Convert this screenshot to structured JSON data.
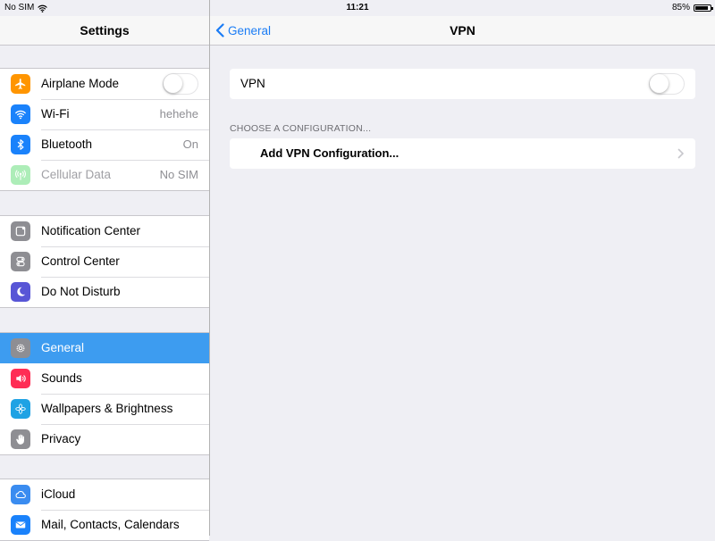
{
  "status_bar": {
    "carrier": "No SIM",
    "time": "11:21",
    "battery_text": "85%",
    "battery_level": 0.85
  },
  "master": {
    "title": "Settings",
    "groups": [
      {
        "items": [
          {
            "label": "Airplane Mode",
            "icon": "airplane-icon",
            "color": "#ff9500",
            "toggle": false
          },
          {
            "label": "Wi-Fi",
            "icon": "wifi-icon",
            "color": "#1a82fb",
            "value": "hehehe"
          },
          {
            "label": "Bluetooth",
            "icon": "bluetooth-icon",
            "color": "#1a82fb",
            "value": "On"
          },
          {
            "label": "Cellular Data",
            "icon": "cellular-icon",
            "color": "#4cd964",
            "value": "No SIM",
            "disabled": true
          }
        ]
      },
      {
        "items": [
          {
            "label": "Notification Center",
            "icon": "notification-center-icon",
            "color": "#8e8e93"
          },
          {
            "label": "Control Center",
            "icon": "control-center-icon",
            "color": "#8e8e93"
          },
          {
            "label": "Do Not Disturb",
            "icon": "moon-icon",
            "color": "#5856d6"
          }
        ]
      },
      {
        "items": [
          {
            "label": "General",
            "icon": "gear-icon",
            "color": "#8e8e93",
            "selected": true
          },
          {
            "label": "Sounds",
            "icon": "speaker-icon",
            "color": "#ff2d55"
          },
          {
            "label": "Wallpapers & Brightness",
            "icon": "wallpaper-icon",
            "color": "#1fa2e4"
          },
          {
            "label": "Privacy",
            "icon": "hand-icon",
            "color": "#8e8e93"
          }
        ]
      },
      {
        "items": [
          {
            "label": "iCloud",
            "icon": "cloud-icon",
            "color": "#3a8cf0"
          },
          {
            "label": "Mail, Contacts, Calendars",
            "icon": "mail-icon",
            "color": "#1a82fb"
          }
        ]
      }
    ]
  },
  "detail": {
    "back_label": "General",
    "title": "VPN",
    "vpn_label": "VPN",
    "vpn_toggle": false,
    "section_header": "CHOOSE A CONFIGURATION...",
    "add_config_label": "Add VPN Configuration..."
  },
  "colors": {
    "accent": "#1a7cf5",
    "selected_row": "#3d9cf0",
    "background": "#efeff4"
  }
}
